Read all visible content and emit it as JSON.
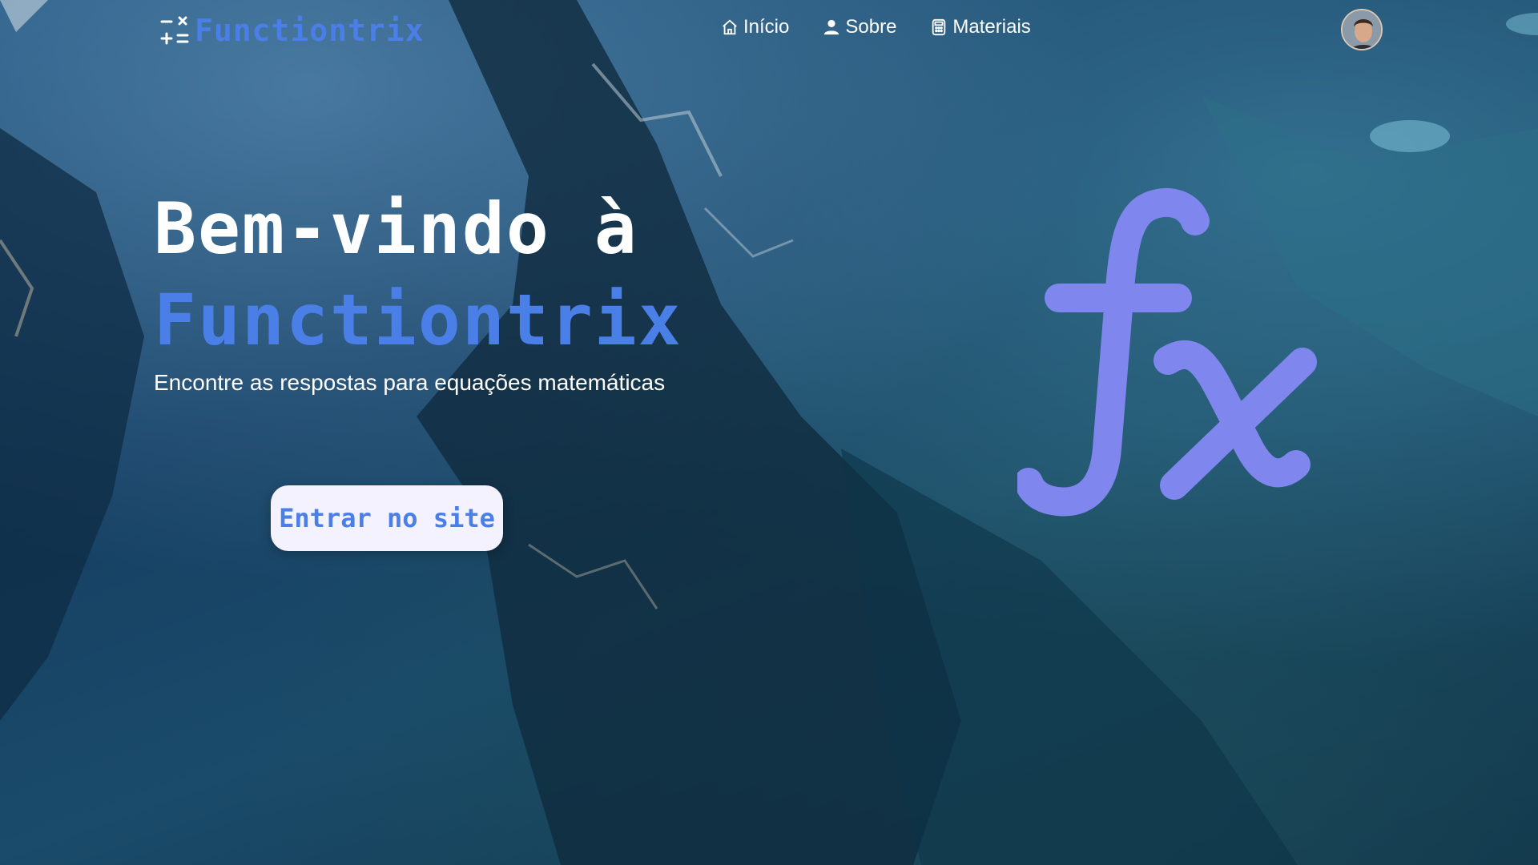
{
  "brand": {
    "name": "Functiontrix",
    "logo_icon": "math-operators-icon"
  },
  "nav": {
    "items": [
      {
        "label": "Início",
        "icon": "home-icon"
      },
      {
        "label": "Sobre",
        "icon": "user-icon"
      },
      {
        "label": "Materiais",
        "icon": "calculator-icon"
      }
    ]
  },
  "user": {
    "avatar": "avatar"
  },
  "hero": {
    "title_line1": "Bem-vindo à",
    "title_line2": "Functiontrix",
    "subtitle": "Encontre as respostas para equações matemáticas",
    "cta_label": "Entrar no site",
    "graphic": "fx-function-icon"
  },
  "colors": {
    "accent": "#4a7fe8",
    "fx_purple": "#7f86ee",
    "button_bg": "#f4f2ff",
    "text": "#ffffff"
  }
}
